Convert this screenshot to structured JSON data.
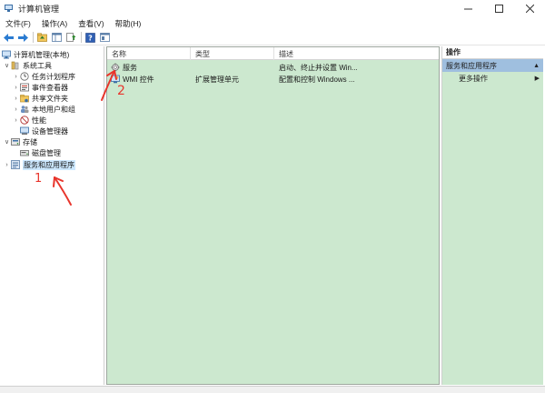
{
  "window": {
    "title": "计算机管理"
  },
  "menu": [
    {
      "label": "文件(F)"
    },
    {
      "label": "操作(A)"
    },
    {
      "label": "查看(V)"
    },
    {
      "label": "帮助(H)"
    }
  ],
  "tree": {
    "root": "计算机管理(本地)",
    "system_tools": "系统工具",
    "task_scheduler": "任务计划程序",
    "event_viewer": "事件查看器",
    "shared_folders": "共享文件夹",
    "local_users": "本地用户和组",
    "performance": "性能",
    "device_manager": "设备管理器",
    "storage": "存储",
    "disk_management": "磁盘管理",
    "services_apps": "服务和应用程序"
  },
  "list": {
    "columns": {
      "name": "名称",
      "type": "类型",
      "desc": "描述"
    },
    "rows": [
      {
        "name": "服务",
        "type": "",
        "desc": "启动、终止并设置 Win..."
      },
      {
        "name": "WMI 控件",
        "type": "扩展管理单元",
        "desc": "配置和控制 Windows ..."
      }
    ]
  },
  "actions": {
    "title": "操作",
    "section": "服务和应用程序",
    "more": "更多操作"
  },
  "annotations": {
    "one": "1",
    "two": "2"
  },
  "colors": {
    "pane_bg": "#cce8cf",
    "annotation": "#e8352c",
    "section_bg": "#9fbfdf"
  }
}
